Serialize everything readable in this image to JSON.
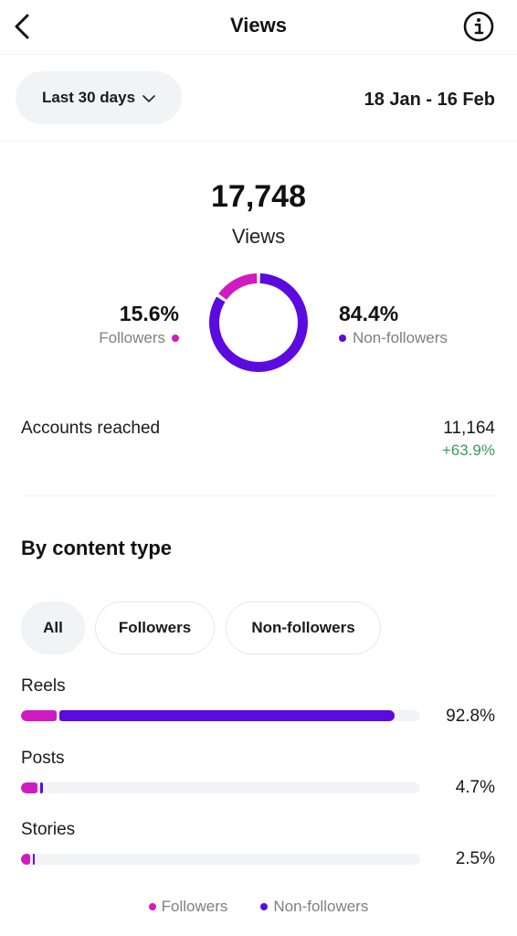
{
  "header": {
    "title": "Views",
    "back_icon": "chevron-left-icon",
    "info_icon": "info-circle-icon"
  },
  "range": {
    "selected": "Last 30 days",
    "dates": "18 Jan - 16 Feb"
  },
  "summary": {
    "total": "17,748",
    "total_label": "Views",
    "followers_pct": "15.6%",
    "followers_label": "Followers",
    "nonfollowers_pct": "84.4%",
    "nonfollowers_label": "Non-followers"
  },
  "colors": {
    "followers": "#d01bc2",
    "nonfollowers": "#5b0ae0",
    "positive": "#3a9a5c"
  },
  "accounts": {
    "label": "Accounts reached",
    "value": "11,164",
    "change": "+63.9%"
  },
  "content_type": {
    "title": "By content type",
    "filters": [
      {
        "label": "All",
        "selected": true
      },
      {
        "label": "Followers",
        "selected": false
      },
      {
        "label": "Non-followers",
        "selected": false
      }
    ],
    "rows": [
      {
        "label": "Reels",
        "pct_text": "92.8%",
        "total_pct": 92.8,
        "followers_pct": 9.0,
        "nonfollowers_pct": 83.8
      },
      {
        "label": "Posts",
        "pct_text": "4.7%",
        "total_pct": 4.7,
        "followers_pct": 4.1,
        "nonfollowers_pct": 0.6
      },
      {
        "label": "Stories",
        "pct_text": "2.5%",
        "total_pct": 2.5,
        "followers_pct": 2.2,
        "nonfollowers_pct": 0.3
      }
    ],
    "legend": {
      "followers": "Followers",
      "nonfollowers": "Non-followers"
    }
  },
  "chart_data": {
    "type": "pie",
    "title": "Views",
    "categories": [
      "Followers",
      "Non-followers"
    ],
    "values": [
      15.6,
      84.4
    ],
    "unit": "%",
    "style": "donut",
    "legend": "sides"
  }
}
